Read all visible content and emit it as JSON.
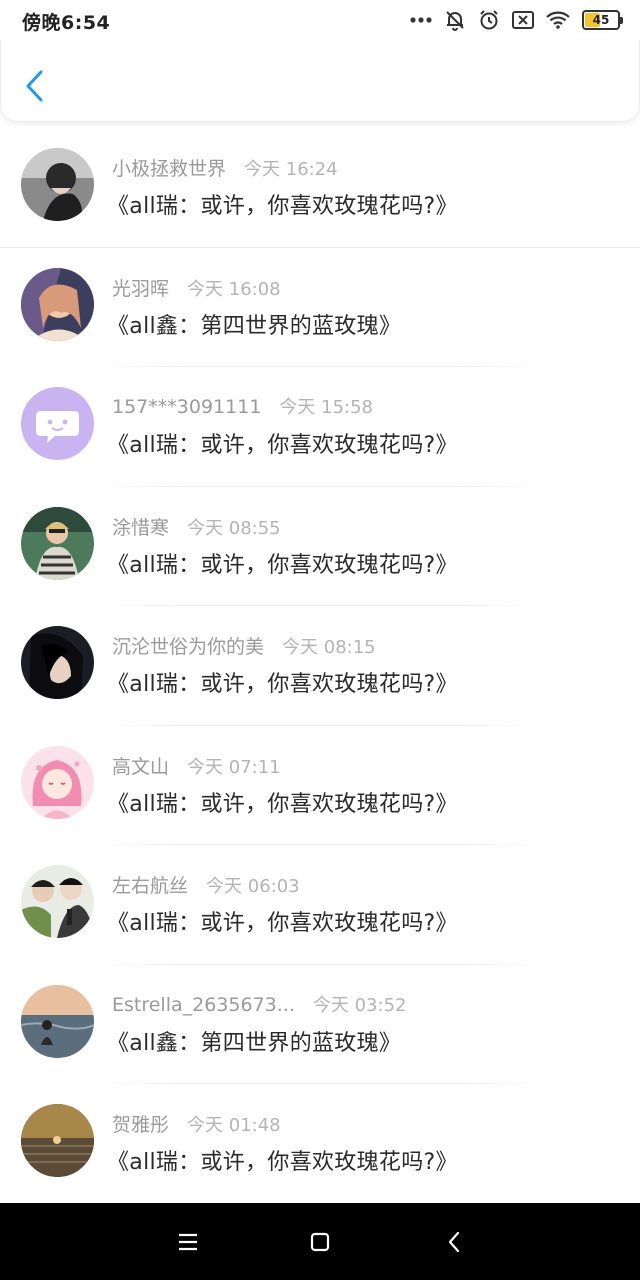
{
  "status": {
    "time": "傍晚6:54",
    "battery": "45",
    "battery_level": 0.45,
    "icons": [
      "more-dots-icon",
      "mute-bell-icon",
      "alarm-clock-icon",
      "sim-off-icon",
      "wifi-icon",
      "battery-icon"
    ]
  },
  "header": {
    "back_icon": "chevron-left-icon",
    "accent": "#2196f3"
  },
  "messages": [
    {
      "name": "小极拯救世界",
      "time": "今天 16:24",
      "text": "《all瑞：或许，你喜欢玫瑰花吗?》"
    },
    {
      "name": "光羽晖",
      "time": "今天 16:08",
      "text": "《all鑫：第四世界的蓝玫瑰》"
    },
    {
      "name": "157***3091111",
      "time": "今天 15:58",
      "text": "《all瑞：或许，你喜欢玫瑰花吗?》"
    },
    {
      "name": "涂惜寒",
      "time": "今天 08:55",
      "text": "《all瑞：或许，你喜欢玫瑰花吗?》"
    },
    {
      "name": "沉沦世俗为你的美",
      "time": "今天 08:15",
      "text": "《all瑞：或许，你喜欢玫瑰花吗?》"
    },
    {
      "name": "高文山",
      "time": "今天 07:11",
      "text": "《all瑞：或许，你喜欢玫瑰花吗?》"
    },
    {
      "name": "左右航丝",
      "time": "今天 06:03",
      "text": "《all瑞：或许，你喜欢玫瑰花吗?》"
    },
    {
      "name": "Estrella_2635673...",
      "time": "今天 03:52",
      "text": "《all鑫：第四世界的蓝玫瑰》"
    },
    {
      "name": "贺雅彤",
      "time": "今天 01:48",
      "text": "《all瑞：或许，你喜欢玫瑰花吗?》"
    }
  ],
  "navbar": {
    "icons": [
      "menu-icon",
      "home-square-icon",
      "back-triangle-icon"
    ]
  }
}
